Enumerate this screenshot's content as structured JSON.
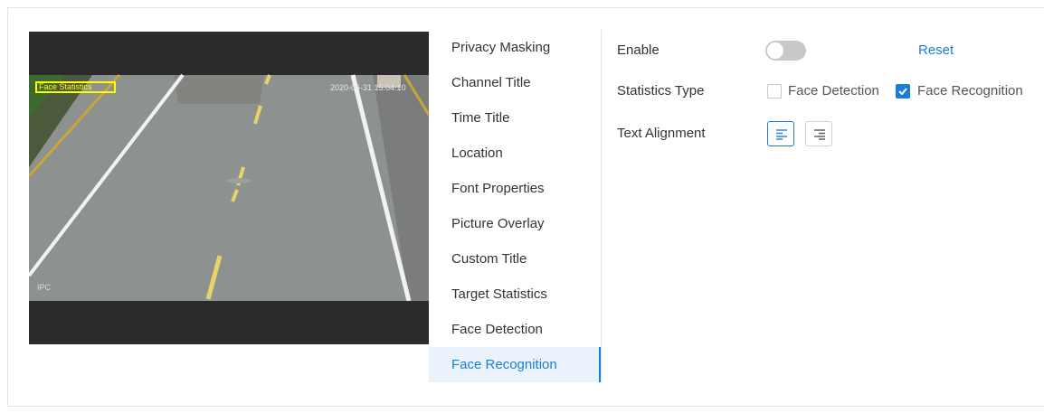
{
  "video": {
    "title_overlay": "Face Statistics",
    "time_overlay": "2020-06-31 15:04:10",
    "channel_overlay": "IPC"
  },
  "menu": {
    "items": [
      {
        "label": "Privacy Masking",
        "active": false
      },
      {
        "label": "Channel Title",
        "active": false
      },
      {
        "label": "Time Title",
        "active": false
      },
      {
        "label": "Location",
        "active": false
      },
      {
        "label": "Font Properties",
        "active": false
      },
      {
        "label": "Picture Overlay",
        "active": false
      },
      {
        "label": "Custom Title",
        "active": false
      },
      {
        "label": "Target Statistics",
        "active": false
      },
      {
        "label": "Face Detection",
        "active": false
      },
      {
        "label": "Face Recognition",
        "active": true
      }
    ]
  },
  "settings": {
    "enable_label": "Enable",
    "enable_on": false,
    "reset_label": "Reset",
    "statistics_type_label": "Statistics Type",
    "options": [
      {
        "label": "Face Detection",
        "checked": false
      },
      {
        "label": "Face Recognition",
        "checked": true
      }
    ],
    "text_alignment_label": "Text Alignment",
    "alignment": "left"
  },
  "colors": {
    "accent": "#1a7ddb",
    "overlay_box": "#ffff00",
    "toggle_off": "#c8c8c8"
  }
}
